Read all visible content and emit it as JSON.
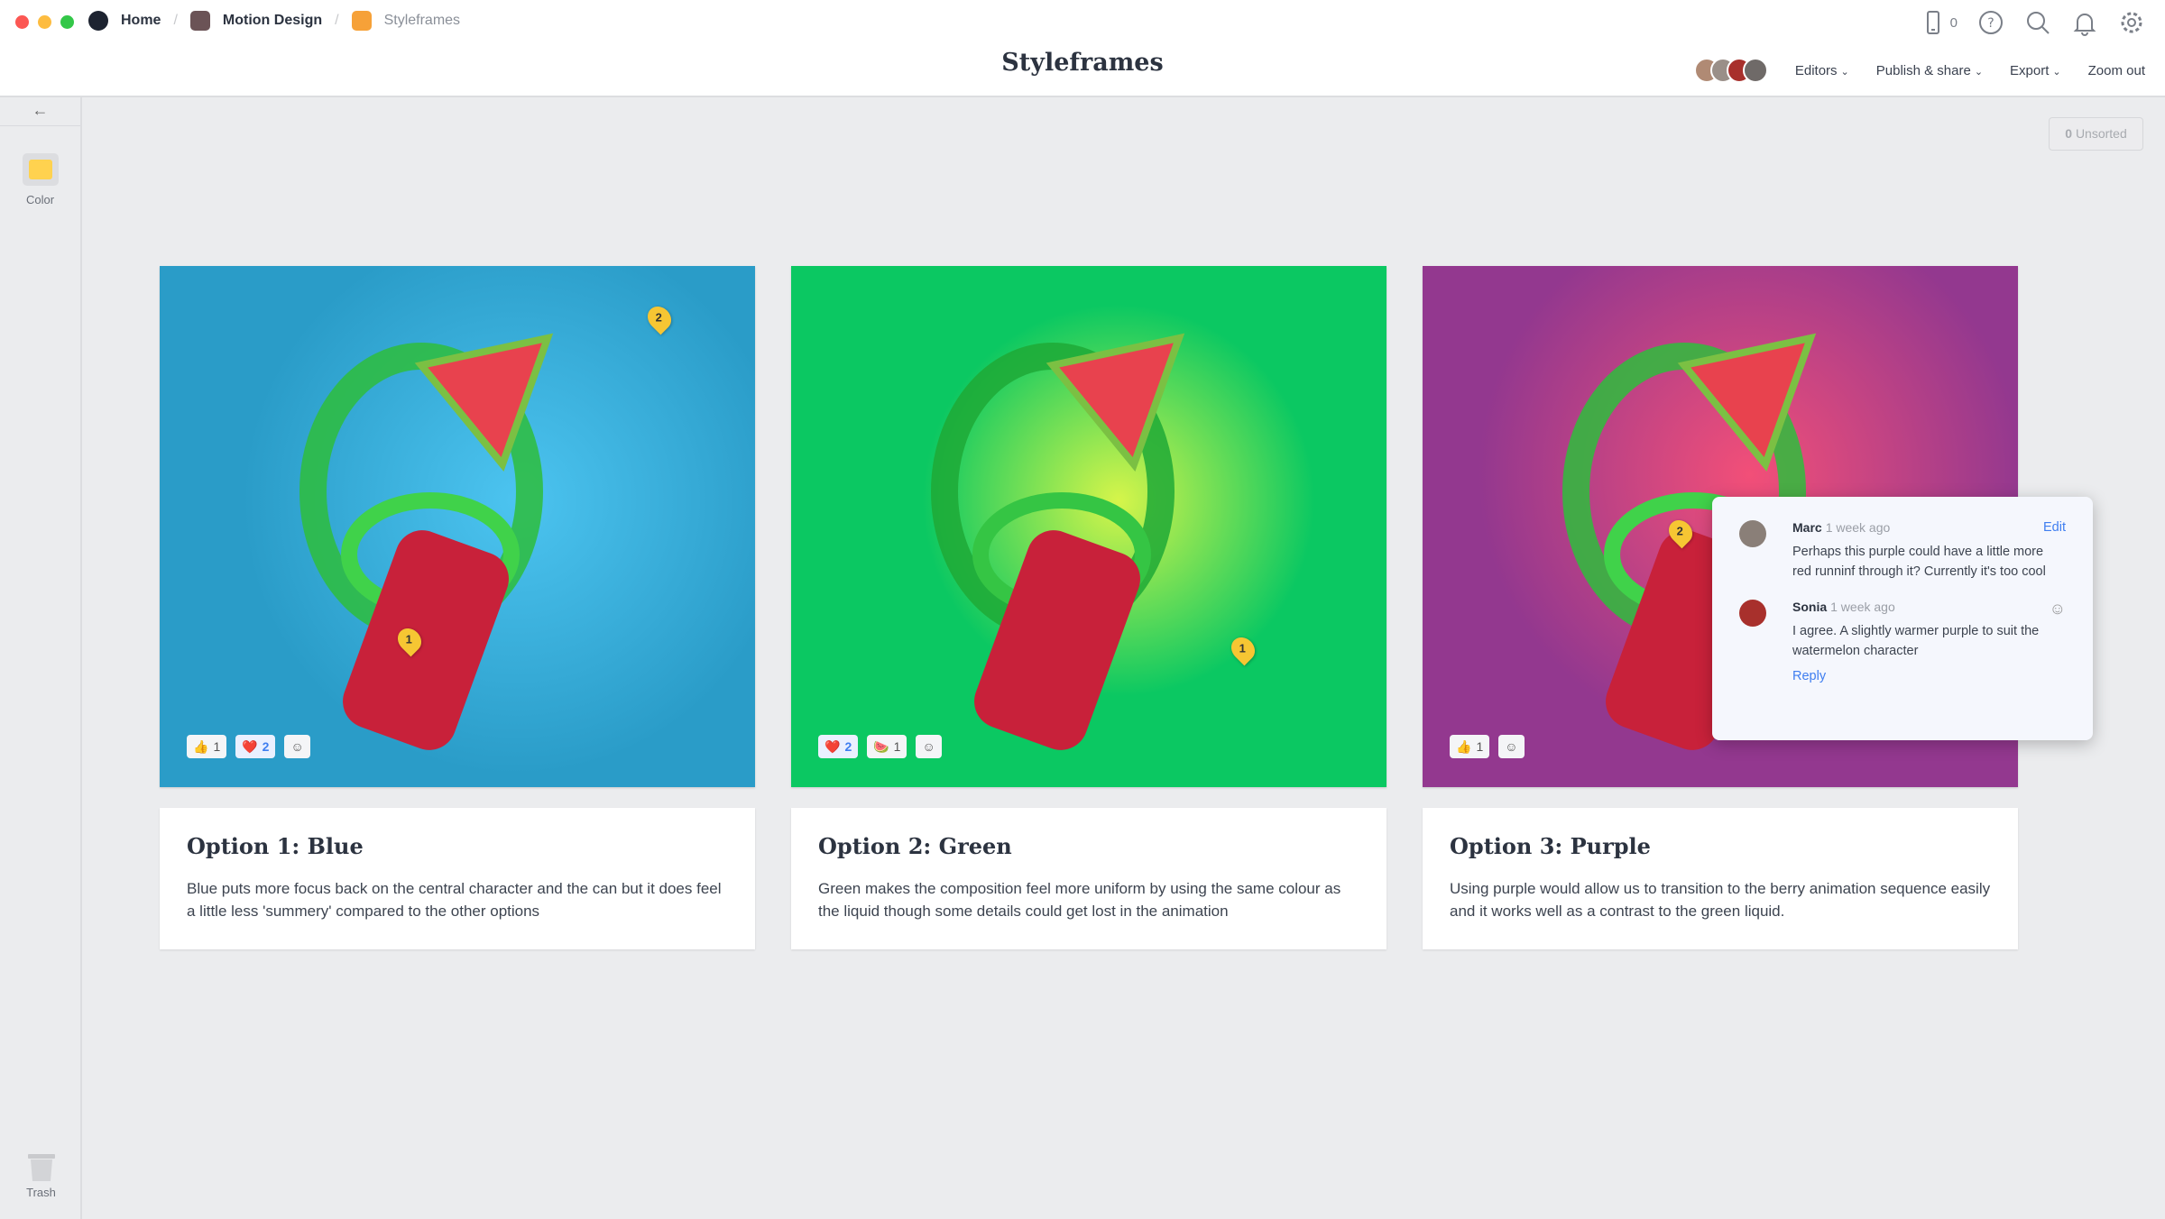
{
  "breadcrumb": {
    "home": "Home",
    "project": "Motion Design",
    "board": "Styleframes"
  },
  "colors": {
    "close": "#fc5753",
    "minimize": "#fdbc40",
    "zoom": "#33c748",
    "project_icon": "#6b5356",
    "board_icon": "#f6a138",
    "accent": "#3f7ef0",
    "pin": "#f6c633"
  },
  "header": {
    "title": "Styleframes",
    "device_count": "0",
    "editors": "Editors",
    "publish": "Publish & share",
    "export": "Export",
    "zoom_out": "Zoom out"
  },
  "sidebar": {
    "color_label": "Color",
    "trash_label": "Trash"
  },
  "unsorted": {
    "count": "0",
    "label": "Unsorted"
  },
  "cards": [
    {
      "title": "Option 1: Blue",
      "text": "Blue puts more focus back on the central character and the can but it does feel a little less 'summery' compared to the other options",
      "bg": "#2a9cc8",
      "pins": [
        "2",
        "1"
      ],
      "reactions": [
        {
          "emoji": "👍",
          "count": "1"
        },
        {
          "emoji": "❤️",
          "count": "2"
        }
      ]
    },
    {
      "title": "Option 2: Green",
      "text": "Green makes the composition feel more uniform by using the same colour as the liquid though some details could get lost in the animation",
      "bg": "#0bc862",
      "pins": [
        "1"
      ],
      "reactions": [
        {
          "emoji": "❤️",
          "count": "2"
        },
        {
          "emoji": "🍉",
          "count": "1"
        }
      ]
    },
    {
      "title": "Option 3: Purple",
      "text": "Using purple would allow us to transition to the berry animation sequence easily and it works well as a contrast to the green liquid.",
      "bg": "#93388f",
      "pins": [
        "2"
      ],
      "reactions": [
        {
          "emoji": "👍",
          "count": "1"
        }
      ]
    }
  ],
  "comments": [
    {
      "author": "Marc",
      "time": "1 week ago",
      "text": "Perhaps this purple could have a little more red runninf through it? Currently it's too cool",
      "action": "Edit"
    },
    {
      "author": "Sonia",
      "time": "1 week ago",
      "text": "I agree. A slightly warmer purple to suit the watermelon character",
      "action": "Reply"
    }
  ]
}
